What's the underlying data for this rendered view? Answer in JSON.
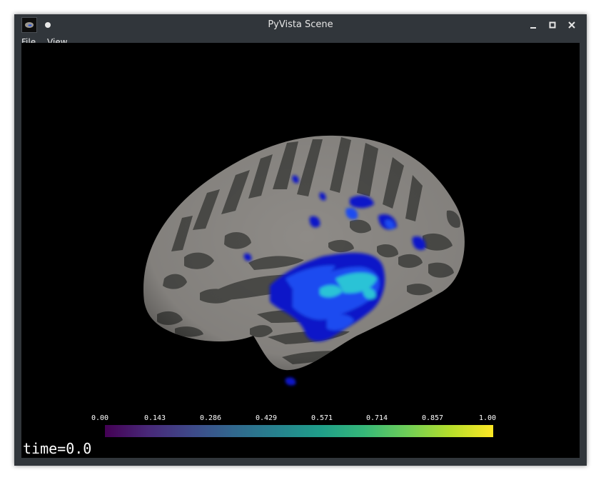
{
  "window": {
    "title": "PyVista Scene",
    "app_icon": "brain-thumbnail-icon",
    "pin_icon": "pin-dot-icon",
    "controls": {
      "minimize_icon": "minimize-icon",
      "maximize_icon": "maximize-icon",
      "close_icon": "close-icon"
    }
  },
  "menubar": {
    "items": [
      {
        "label": "File"
      },
      {
        "label": "View"
      }
    ]
  },
  "scene": {
    "background": "#000000",
    "surface_colors": {
      "gyri": "#8e8b87",
      "sulci": "#4c4c49"
    },
    "overlay_colors": [
      "#0a16c8",
      "#1a4cf0",
      "#2bc3d6"
    ]
  },
  "colorbar": {
    "colormap": "viridis",
    "ticks": [
      "0.00",
      "0.143",
      "0.286",
      "0.429",
      "0.571",
      "0.714",
      "0.857",
      "1.00"
    ]
  },
  "time_label": "time=0.0"
}
